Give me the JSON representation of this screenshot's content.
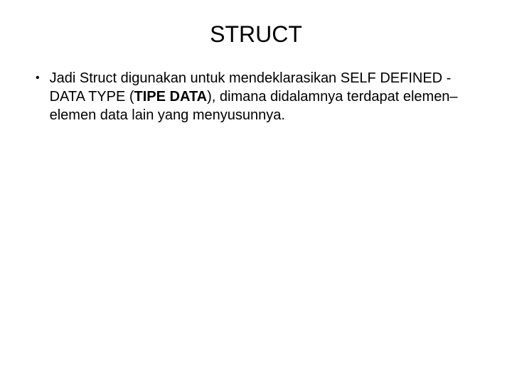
{
  "slide": {
    "title": "STRUCT",
    "bullet": {
      "marker": "•",
      "text_part1": "Jadi Struct digunakan untuk mendeklarasikan SELF DEFINED - DATA TYPE (",
      "text_bold": "TIPE DATA",
      "text_part2": "), dimana didalamnya terdapat elemen–elemen data lain yang menyusunnya."
    }
  }
}
